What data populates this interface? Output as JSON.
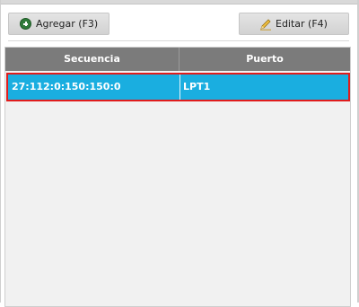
{
  "toolbar": {
    "add_label": "Agregar (F3)",
    "edit_label": "Editar (F4)"
  },
  "table": {
    "columns": [
      "Secuencia",
      "Puerto"
    ],
    "rows": [
      {
        "sequence": "27:112:0:150:150:0",
        "port": "LPT1",
        "selected": true
      }
    ]
  },
  "colors": {
    "header_bg": "#7b7b7b",
    "selected_row_bg": "#1aaee0",
    "selected_row_outline": "#e01c1c",
    "add_icon": "#2f7a39"
  },
  "icons": {
    "add": "plus-circle-icon",
    "edit": "pencil-icon"
  }
}
